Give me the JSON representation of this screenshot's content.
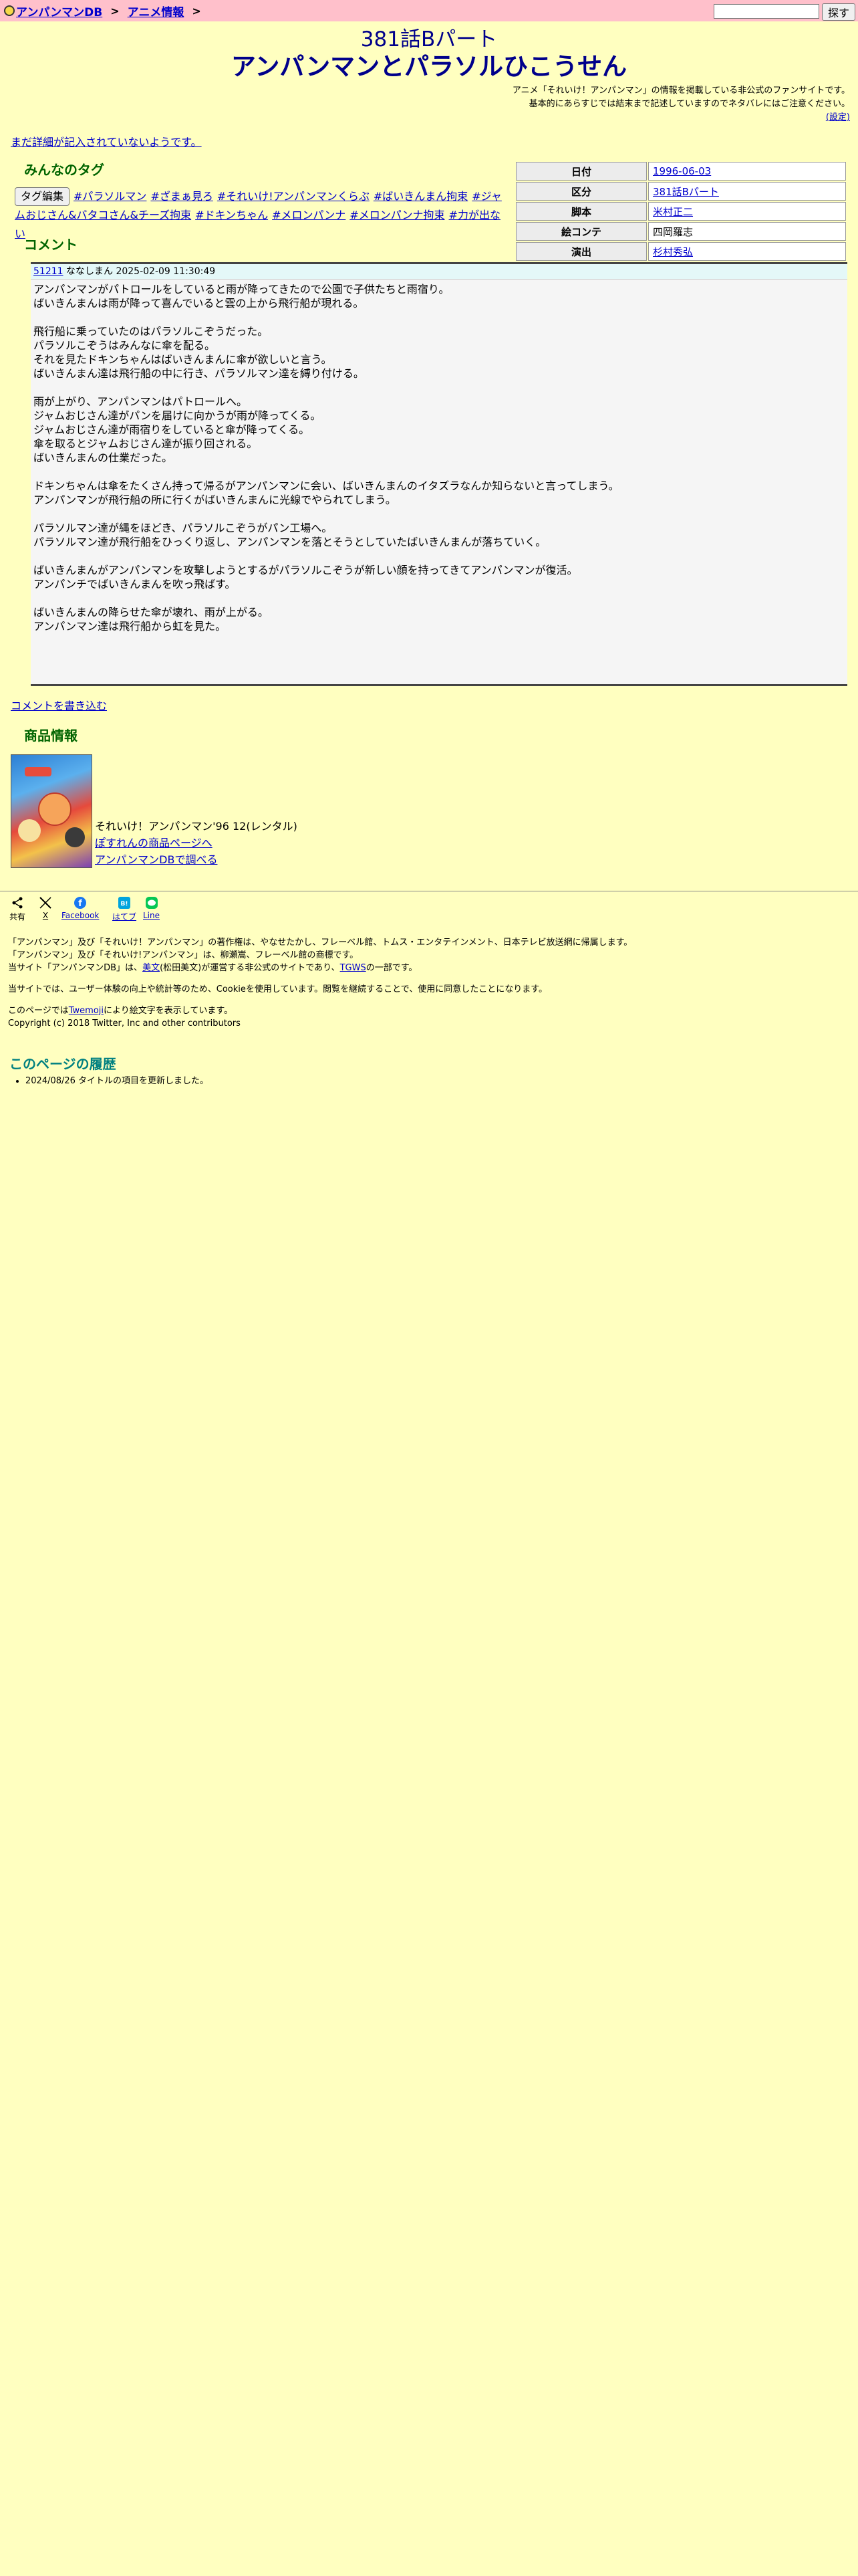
{
  "topbar": {
    "home_label": "アンパンマンDB",
    "sep1": ">",
    "anime_label": "アニメ情報",
    "sep2": ">",
    "search_button": "探す"
  },
  "title": {
    "sub": "381話Bパート",
    "main": "アンパンマンとパラソルひこうせん"
  },
  "notice": {
    "line1": "アニメ「それいけ！アンパンマン」の情報を掲載している非公式のファンサイトです。",
    "line2": "基本的にあらすじでは結末まで記述していますのでネタバレにはご注意ください。",
    "settings_link": "(設定)"
  },
  "no_detail_link": "まだ詳細が記入されていないようです。",
  "tags": {
    "heading": "みんなのタグ",
    "edit_button": "タグ編集",
    "items": [
      "#パラソルマン",
      "#ざまぁ見ろ",
      "#それいけ!アンパンマンくらぶ",
      "#ばいきんまん拘束",
      "#ジャムおじさん&バタコさん&チーズ拘束",
      "#ドキンちゃん",
      "#メロンパンナ",
      "#メロンパンナ拘束",
      "#力が出ない"
    ]
  },
  "info_table": {
    "rows": [
      {
        "label": "日付",
        "value": "1996-06-03"
      },
      {
        "label": "区分",
        "value": "381話Bパート"
      },
      {
        "label": "脚本",
        "value": "米村正二"
      },
      {
        "label": "絵コンテ",
        "value": "四岡羅志"
      },
      {
        "label": "演出",
        "value": "杉村秀弘"
      }
    ]
  },
  "comments": {
    "heading": "コメント",
    "id": "51211",
    "meta": "ななしまん 2025-02-09 11:30:49",
    "body": "アンパンマンがパトロールをしていると雨が降ってきたので公園で子供たちと雨宿り。\nばいきんまんは雨が降って喜んでいると雲の上から飛行船が現れる。\n\n飛行船に乗っていたのはパラソルこぞうだった。\nパラソルこぞうはみんなに傘を配る。\nそれを見たドキンちゃんはばいきんまんに傘が欲しいと言う。\nばいきんまん達は飛行船の中に行き、パラソルマン達を縛り付ける。\n\n雨が上がり、アンパンマンはパトロールへ。\nジャムおじさん達がパンを届けに向かうが雨が降ってくる。\nジャムおじさん達が雨宿りをしていると傘が降ってくる。\n傘を取るとジャムおじさん達が振り回される。\nばいきんまんの仕業だった。\n\nドキンちゃんは傘をたくさん持って帰るがアンパンマンに会い、ばいきんまんのイタズラなんか知らないと言ってしまう。\nアンパンマンが飛行船の所に行くがばいきんまんに光線でやられてしまう。\n\nパラソルマン達が縄をほどき、パラソルこぞうがパン工場へ。\nパラソルマン達が飛行船をひっくり返し、アンパンマンを落とそうとしていたばいきんまんが落ちていく。\n\nばいきんまんがアンパンマンを攻撃しようとするがパラソルこぞうが新しい顔を持ってきてアンパンマンが復活。\nアンパンチでばいきんまんを吹っ飛ばす。\n\nばいきんまんの降らせた傘が壊れ、雨が上がる。\nアンパンマン達は飛行船から虹を見た。",
    "write_link": "コメントを書き込む"
  },
  "products": {
    "heading": "商品情報",
    "title": "それいけ！アンパンマン'96 12(レンタル)",
    "link1": "ぽすれんの商品ページへ",
    "link2": "アンパンマンDBで調べる"
  },
  "share": {
    "share_label": "共有",
    "x_label": "X",
    "facebook_label": "Facebook",
    "hatena_label": "はてブ",
    "line_label": "Line"
  },
  "footer": {
    "line1": "「アンパンマン」及び「それいけ！アンパンマン」の著作権は、やなせたかし、フレーベル館、トムス・エンタテインメント、日本テレビ放送網に帰属します。",
    "line2": "「アンパンマン」及び「それいけ!アンパンマン」は、柳瀬嵩、フレーベル館の商標です。",
    "line3_pre": "当サイト「アンパンマンDB」は、",
    "line3_link1": "美文",
    "line3_mid": "(松田美文)が運営する非公式のサイトであり、",
    "line3_link2": "TGWS",
    "line3_post": "の一部です。",
    "cookie": "当サイトでは、ユーザー体験の向上や統計等のため、Cookieを使用しています。閲覧を継続することで、使用に同意したことになります。",
    "emoji_pre": "このページでは",
    "emoji_link": "Twemoji",
    "emoji_post": "により絵文字を表示しています。",
    "copyright": "Copyright (c) 2018 Twitter, Inc and other contributors"
  },
  "history": {
    "heading": "このページの履歴",
    "items": [
      "2024/08/26 タイトルの項目を更新しました。"
    ]
  }
}
